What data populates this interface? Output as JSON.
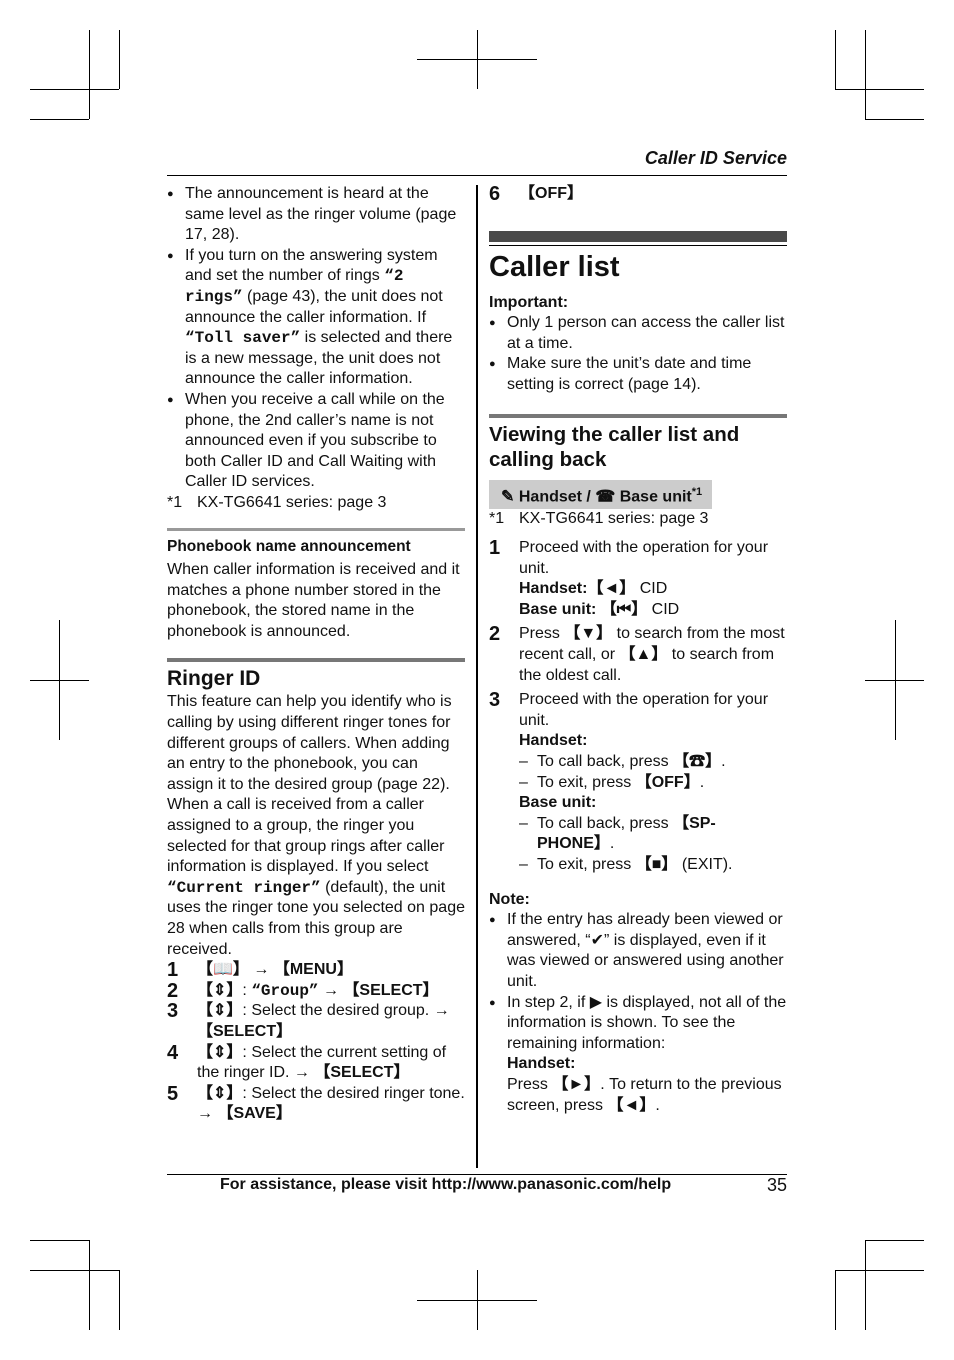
{
  "header": {
    "section_title": "Caller ID Service"
  },
  "footer": {
    "assistance_text": "For assistance, please visit http://www.panasonic.com/help",
    "page_number": "35"
  },
  "left_column": {
    "bullets": [
      {
        "text": "The announcement is heard at the same level as the ringer volume (page 17, 28)."
      },
      {
        "pre": "If you turn on the answering system and set the number of rings ",
        "mono1": "“2 rings”",
        "mid": " (page 43), the unit does not announce the caller information. If ",
        "mono2": "“Toll saver”",
        "post": " is selected and there is a new message, the unit does not announce the caller information."
      },
      {
        "text": "When you receive a call while on the phone, the 2nd caller’s name is not announced even if you subscribe to both Caller ID and Call Waiting with Caller ID services."
      }
    ],
    "footnote": {
      "mark": "*1",
      "text": "KX-TG6641 series: page 3"
    },
    "phonebook": {
      "heading": "Phonebook name announcement",
      "body": "When caller information is received and it matches a phone number stored in the phonebook, the stored name in the phonebook is announced."
    },
    "ringer_id": {
      "heading": "Ringer ID",
      "body_pre": "This feature can help you identify who is calling by using different ringer tones for different groups of callers. When adding an entry to the phonebook, you can assign it to the desired group (page 22). When a call is received from a caller assigned to a group, the ringer you selected for that group rings after caller information is displayed. If you select ",
      "body_mono": "“Current ringer”",
      "body_post": " (default), the unit uses the ringer tone you selected on page 28 when calls from this group are received.",
      "steps": [
        {
          "n": "1",
          "a": "【📖】",
          "b": " → ",
          "c": "【MENU】",
          "d": ""
        },
        {
          "n": "2",
          "a": "【⇕】",
          "b": ": ",
          "c": "“Group”",
          "d": " → 【SELECT】"
        },
        {
          "n": "3",
          "a": "【⇕】",
          "b": ": Select the desired group. → ",
          "c": "【SELECT】",
          "d": ""
        },
        {
          "n": "4",
          "a": "【⇕】",
          "b": ": Select the current setting of the ringer ID. → ",
          "c": "【SELECT】",
          "d": ""
        },
        {
          "n": "5",
          "a": "【⇕】",
          "b": ": Select the desired ringer tone. → ",
          "c": "【SAVE】",
          "d": ""
        }
      ]
    }
  },
  "right_column": {
    "step6": {
      "n": "6",
      "key": "【OFF】"
    },
    "title": "Caller list",
    "important_label": "Important:",
    "important_bullets": [
      "Only 1 person can access the caller list at a time.",
      "Make sure the unit’s date and time setting is correct (page 14)."
    ],
    "viewing": {
      "heading": "Viewing the caller list and calling back",
      "badge_handset": "Handset / ",
      "badge_base": "Base unit",
      "badge_sup": "*1",
      "footnote_mark": "*1",
      "footnote_text": "KX-TG6641 series: page 3",
      "step1": {
        "n": "1",
        "text": "Proceed with the operation for your unit.",
        "handset_label": "Handset:",
        "handset_key": "【◄】",
        "handset_val": " CID",
        "base_label": "Base unit: ",
        "base_key": "【⏮】",
        "base_val": " CID"
      },
      "step2": {
        "n": "2",
        "pre": "Press ",
        "k1": "【▼】",
        "mid": " to search from the most recent call, or ",
        "k2": "【▲】",
        "post": " to search from the oldest call."
      },
      "step3": {
        "n": "3",
        "text": "Proceed with the operation for your unit.",
        "handset_label": "Handset:",
        "handset_items": [
          {
            "pre": "To call back, press ",
            "key": "【☎】",
            "post": "."
          },
          {
            "pre": "To exit, press ",
            "key": "【OFF】",
            "post": "."
          }
        ],
        "base_label": "Base unit:",
        "base_items": [
          {
            "pre": "To call back, press ",
            "key": "【SP-PHONE】",
            "post": "."
          },
          {
            "pre": "To exit, press ",
            "key": "【■】",
            "post": " (EXIT)."
          }
        ]
      }
    },
    "note": {
      "label": "Note:",
      "b1_pre": "If the entry has already been viewed or answered, “",
      "b1_sym": "✔",
      "b1_post": "” is displayed, even if it was viewed or answered using another unit.",
      "b2_pre": "In step 2, if ",
      "b2_sym": "▶",
      "b2_post": " is displayed, not all of the information is shown. To see the remaining information:",
      "b2_handset": "Handset:",
      "b2_press": "Press ",
      "b2_k1": "【►】",
      "b2_mid": ". To return to the previous screen, press ",
      "b2_k2": "【◄】",
      "b2_end": "."
    }
  }
}
